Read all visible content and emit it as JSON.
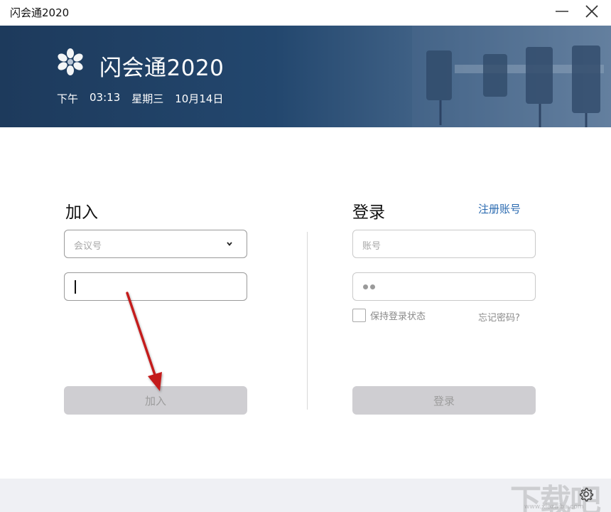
{
  "window": {
    "title": "闪会通2020"
  },
  "banner": {
    "app_name": "闪会通2020",
    "ampm": "下午",
    "time": "03:13",
    "weekday": "星期三",
    "date": "10月14日"
  },
  "join": {
    "title": "加入",
    "meeting_placeholder": "会议号",
    "button_label": "加入"
  },
  "login": {
    "title": "登录",
    "register_link": "注册账号",
    "account_placeholder": "账号",
    "remember_label": "保持登录状态",
    "forgot_link": "忘记密码?",
    "button_label": "登录"
  },
  "footer": {
    "watermark": "下载吧",
    "watermark_url": "www.xiazaiba.com"
  },
  "colors": {
    "banner_dark": "#1d3a5c",
    "link": "#2a6ab0",
    "disabled_button": "#cfced2",
    "annotation_arrow": "#c41a1a"
  },
  "icons": {
    "minimize": "minimize-icon",
    "close": "close-icon",
    "logo": "app-logo-icon",
    "dropdown": "chevron-down-icon",
    "settings": "gear-icon"
  }
}
